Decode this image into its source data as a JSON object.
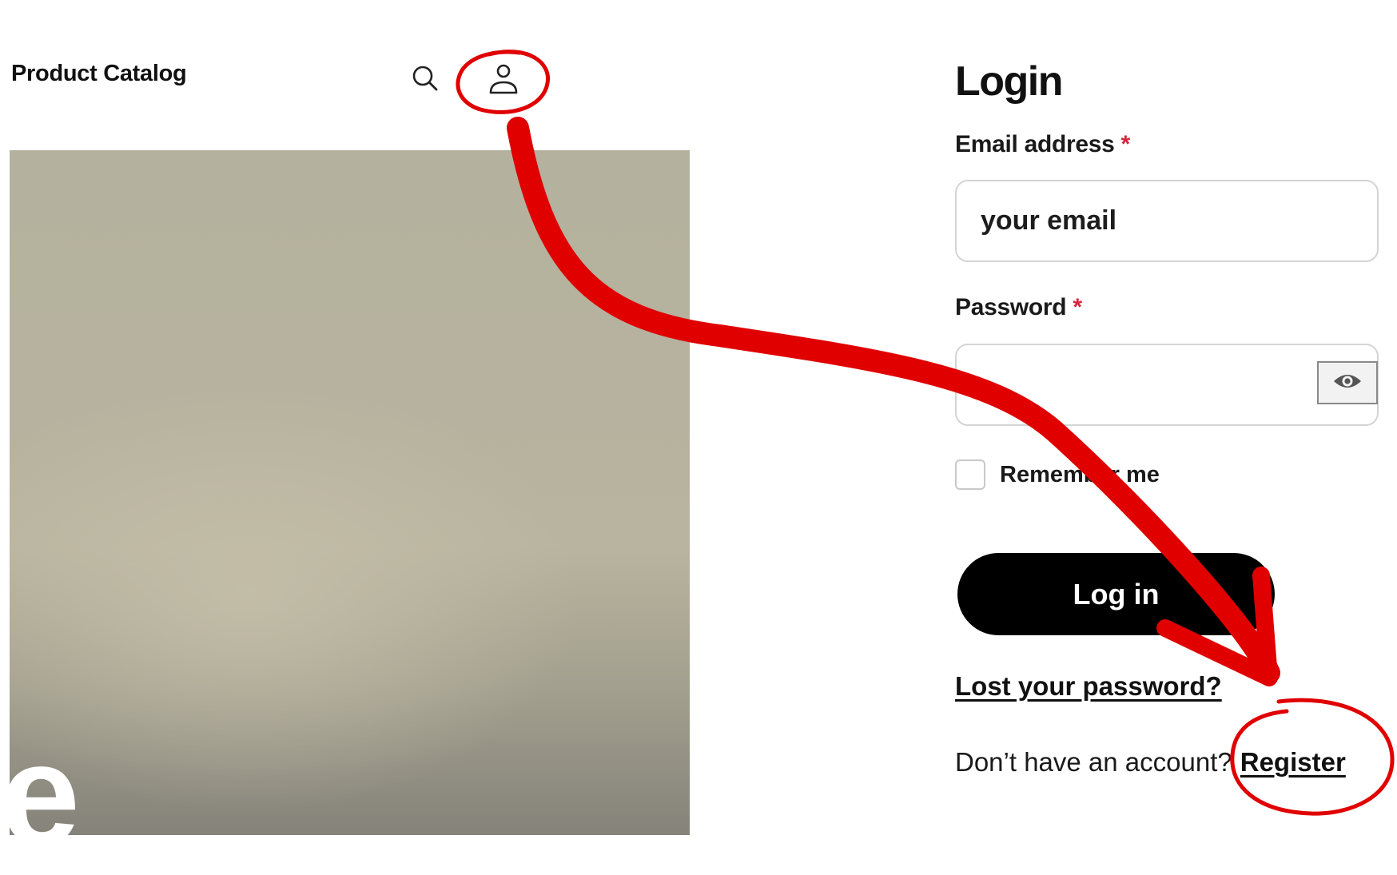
{
  "header": {
    "site_title": "Product Catalog",
    "icons": [
      "search-icon",
      "account-icon"
    ]
  },
  "hero": {
    "overlay_text": "e"
  },
  "login": {
    "title": "Login",
    "email_label": "Email address",
    "email_placeholder": "your email",
    "password_label": "Password",
    "required_marker": "*",
    "remember_label": "Remember me",
    "submit_label": "Log in",
    "lost_password_link": "Lost your password?",
    "no_account_text": "Don’t have an account?",
    "register_link": "Register"
  },
  "colors": {
    "annotation_red": "#e00000",
    "required_red": "#d6263c",
    "button_black": "#000000"
  }
}
